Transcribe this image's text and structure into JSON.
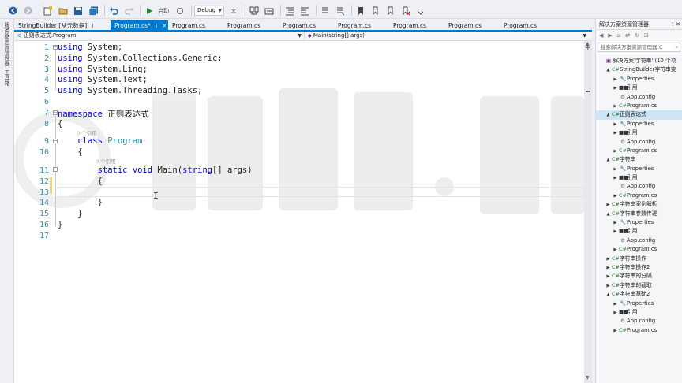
{
  "toolbar": {
    "start_label": "启动",
    "config_value": "Debug"
  },
  "left_strip": {
    "label_top": "服务器资源管理器",
    "label_bottom": "工具箱"
  },
  "tabs": [
    {
      "label": "StringBuilder [从元数据]",
      "icon": "pin-icon",
      "active": false
    },
    {
      "label": "Program.cs*",
      "icon": "pin-icon",
      "active": true
    },
    {
      "label": "Program.cs",
      "active": false
    },
    {
      "label": "Program.cs",
      "active": false
    },
    {
      "label": "Program.cs",
      "active": false
    },
    {
      "label": "Program.cs",
      "active": false
    },
    {
      "label": "Program.cs",
      "active": false
    },
    {
      "label": "Program.cs",
      "active": false
    },
    {
      "label": "Program.cs",
      "active": false
    }
  ],
  "navbar": {
    "left": "正则表达式.Program",
    "right": "Main(string[] args)"
  },
  "editor": {
    "line_numbers": [
      "1",
      "2",
      "3",
      "4",
      "5",
      "6",
      "7",
      "8",
      "9",
      "10",
      "11",
      "12",
      "13",
      "14",
      "15",
      "16",
      "17"
    ],
    "lines": [
      [
        {
          "t": "using",
          "c": "kw"
        },
        {
          "t": " System;",
          "c": ""
        }
      ],
      [
        {
          "t": "using",
          "c": "kw"
        },
        {
          "t": " System.Collections.Generic;",
          "c": ""
        }
      ],
      [
        {
          "t": "using",
          "c": "kw"
        },
        {
          "t": " System.Linq;",
          "c": ""
        }
      ],
      [
        {
          "t": "using",
          "c": "kw"
        },
        {
          "t": " System.Text;",
          "c": ""
        }
      ],
      [
        {
          "t": "using",
          "c": "kw"
        },
        {
          "t": " System.Threading.Tasks;",
          "c": ""
        }
      ],
      [],
      [
        {
          "t": "namespace",
          "c": "kw"
        },
        {
          "t": " 正则表达式",
          "c": ""
        }
      ],
      [
        {
          "t": "{",
          "c": ""
        }
      ],
      [
        {
          "t": "    ",
          "c": ""
        },
        {
          "t": "class",
          "c": "kw"
        },
        {
          "t": " ",
          "c": ""
        },
        {
          "t": "Program",
          "c": "cls"
        }
      ],
      [
        {
          "t": "    {",
          "c": ""
        }
      ],
      [
        {
          "t": "        ",
          "c": ""
        },
        {
          "t": "static",
          "c": "kw"
        },
        {
          "t": " ",
          "c": ""
        },
        {
          "t": "void",
          "c": "kw"
        },
        {
          "t": " Main(",
          "c": ""
        },
        {
          "t": "string",
          "c": "kw"
        },
        {
          "t": "[] args)",
          "c": ""
        }
      ],
      [
        {
          "t": "        {",
          "c": ""
        }
      ],
      [],
      [
        {
          "t": "        }",
          "c": ""
        }
      ],
      [
        {
          "t": "    }",
          "c": ""
        }
      ],
      [
        {
          "t": "}",
          "c": ""
        }
      ],
      []
    ],
    "ref_hint_class": "0 个引用",
    "ref_hint_method": "0 个引用"
  },
  "solution_explorer": {
    "title": "解决方案资源管理器",
    "search_placeholder": "搜索解决方案资源管理器(C",
    "nodes": [
      {
        "label": "解决方案'字符串' (10 个项",
        "level": 0,
        "expander": "",
        "icon": "sln",
        "glyph": "▣"
      },
      {
        "label": "StringBuilder字符串变",
        "level": 1,
        "expander": "▲",
        "icon": "proj",
        "glyph": "C#"
      },
      {
        "label": "Properties",
        "level": 2,
        "expander": "▶",
        "icon": "prop",
        "glyph": "🔧"
      },
      {
        "label": "引用",
        "level": 2,
        "expander": "▶",
        "icon": "refi",
        "glyph": "■■"
      },
      {
        "label": "App.config",
        "level": 2,
        "expander": "",
        "icon": "cfg",
        "glyph": "⚙"
      },
      {
        "label": "Program.cs",
        "level": 2,
        "expander": "▶",
        "icon": "cs",
        "glyph": "C#"
      },
      {
        "label": "正则表达式",
        "level": 1,
        "expander": "▲",
        "icon": "proj",
        "glyph": "C#",
        "selected": true
      },
      {
        "label": "Properties",
        "level": 2,
        "expander": "▶",
        "icon": "prop",
        "glyph": "🔧"
      },
      {
        "label": "引用",
        "level": 2,
        "expander": "▶",
        "icon": "refi",
        "glyph": "■■"
      },
      {
        "label": "App.config",
        "level": 2,
        "expander": "",
        "icon": "cfg",
        "glyph": "⚙"
      },
      {
        "label": "Program.cs",
        "level": 2,
        "expander": "▶",
        "icon": "cs",
        "glyph": "C#"
      },
      {
        "label": "字符串",
        "level": 1,
        "expander": "▲",
        "icon": "proj",
        "glyph": "C#"
      },
      {
        "label": "Properties",
        "level": 2,
        "expander": "▶",
        "icon": "prop",
        "glyph": "🔧"
      },
      {
        "label": "引用",
        "level": 2,
        "expander": "▶",
        "icon": "refi",
        "glyph": "■■"
      },
      {
        "label": "App.config",
        "level": 2,
        "expander": "",
        "icon": "cfg",
        "glyph": "⚙"
      },
      {
        "label": "Program.cs",
        "level": 2,
        "expander": "▶",
        "icon": "cs",
        "glyph": "C#"
      },
      {
        "label": "字符串案例解析",
        "level": 1,
        "expander": "▶",
        "icon": "proj",
        "glyph": "C#"
      },
      {
        "label": "字符串参数传递",
        "level": 1,
        "expander": "▲",
        "icon": "proj",
        "glyph": "C#"
      },
      {
        "label": "Properties",
        "level": 2,
        "expander": "▶",
        "icon": "prop",
        "glyph": "🔧"
      },
      {
        "label": "引用",
        "level": 2,
        "expander": "▶",
        "icon": "refi",
        "glyph": "■■"
      },
      {
        "label": "App.config",
        "level": 2,
        "expander": "",
        "icon": "cfg",
        "glyph": "⚙"
      },
      {
        "label": "Program.cs",
        "level": 2,
        "expander": "▶",
        "icon": "cs",
        "glyph": "C#"
      },
      {
        "label": "字符串操作",
        "level": 1,
        "expander": "▶",
        "icon": "proj",
        "glyph": "C#"
      },
      {
        "label": "字符串操作2",
        "level": 1,
        "expander": "▶",
        "icon": "proj",
        "glyph": "C#"
      },
      {
        "label": "字符串的分隔",
        "level": 1,
        "expander": "▶",
        "icon": "proj",
        "glyph": "C#"
      },
      {
        "label": "字符串的截取",
        "level": 1,
        "expander": "▶",
        "icon": "proj",
        "glyph": "C#"
      },
      {
        "label": "字符串基础2",
        "level": 1,
        "expander": "▲",
        "icon": "proj",
        "glyph": "C#"
      },
      {
        "label": "Properties",
        "level": 2,
        "expander": "▶",
        "icon": "prop",
        "glyph": "🔧"
      },
      {
        "label": "引用",
        "level": 2,
        "expander": "▶",
        "icon": "refi",
        "glyph": "■■"
      },
      {
        "label": "App.config",
        "level": 2,
        "expander": "",
        "icon": "cfg",
        "glyph": "⚙"
      },
      {
        "label": "Program.cs",
        "level": 2,
        "expander": "▶",
        "icon": "cs",
        "glyph": "C#"
      }
    ]
  }
}
